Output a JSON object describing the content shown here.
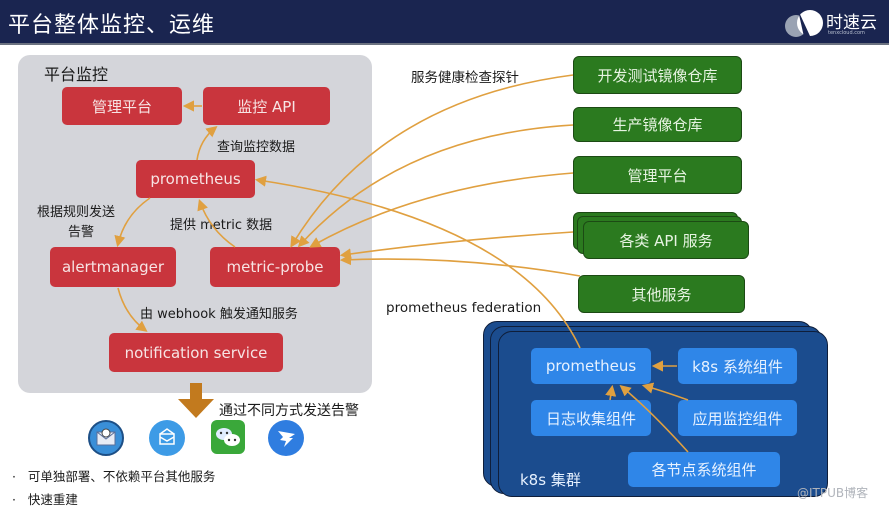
{
  "header": {
    "title": "平台整体监控、运维",
    "logo_text": "时速云",
    "logo_sub": "tenxcloud.com"
  },
  "platform_panel": {
    "title": "平台监控",
    "boxes": {
      "mgmt_platform": "管理平台",
      "monitor_api": "监控 API",
      "prometheus": "prometheus",
      "alertmanager": "alertmanager",
      "metric_probe": "metric-probe",
      "notification_service": "notification service"
    },
    "labels": {
      "query_data": "查询监控数据",
      "send_alert_line1": "根据规则发送",
      "send_alert_line2": "告警",
      "provide_metric": "提供 metric 数据",
      "webhook": "由 webhook 触发通知服务"
    }
  },
  "notify": {
    "label": "通过不同方式发送告警",
    "icons": [
      "email-icon",
      "mail-icon",
      "wechat-icon",
      "dingtalk-icon"
    ]
  },
  "bullets": [
    "可单独部署、不依赖平台其他服务",
    "快速重建"
  ],
  "services": {
    "probe_label": "服务健康检查探针",
    "items": [
      "开发测试镜像仓库",
      "生产镜像仓库",
      "管理平台",
      "各类 API 服务",
      "其他服务"
    ]
  },
  "federation": {
    "label": "prometheus federation"
  },
  "k8s_cluster": {
    "label": "k8s 集群",
    "boxes": {
      "prometheus": "prometheus",
      "k8s_components": "k8s 系统组件",
      "log_collector": "日志收集组件",
      "app_monitor": "应用监控组件",
      "node_components": "各节点系统组件"
    }
  },
  "watermark": "@ITPUB博客",
  "colors": {
    "header_bg": "#1a2550",
    "red_box": "#c9353d",
    "green_box": "#2b7a1f",
    "blue_box": "#2f86e8",
    "cluster_bg": "#1b4c8e",
    "arrow": "#e0a040",
    "down_arrow": "#c27a1e"
  }
}
